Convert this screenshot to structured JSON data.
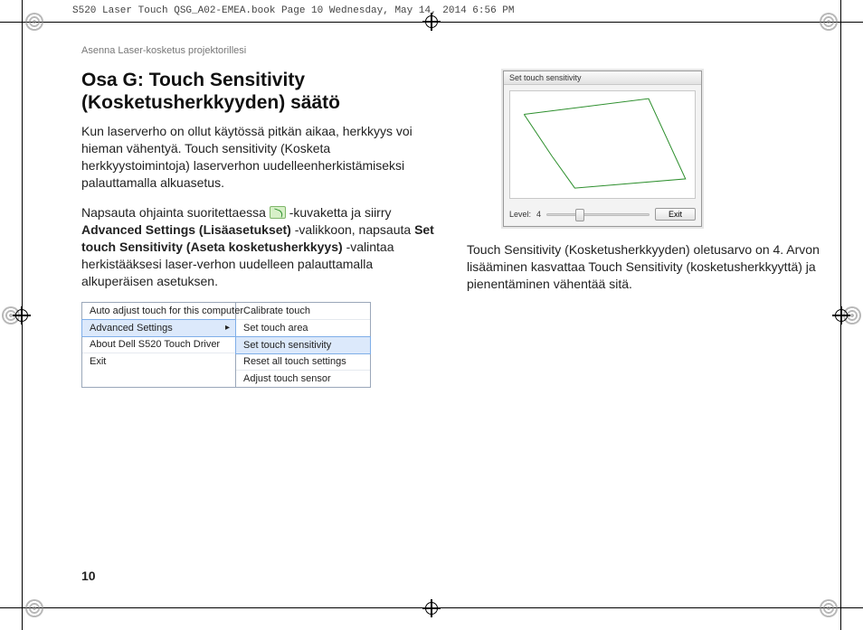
{
  "imprint": "S520 Laser Touch QSG_A02-EMEA.book  Page 10  Wednesday, May 14, 2014  6:56 PM",
  "running_head": "Asenna Laser-kosketus projektorillesi",
  "title_line1": "Osa G: Touch Sensitivity",
  "title_line2": "(Kosketusherkkyyden) säätö",
  "para1": "Kun laserverho on ollut käytössä pitkän aikaa, herkkyys voi hieman vähentyä. Touch sensitivity (Kosketa herkkyystoimintoja) laserverhon uudelleenherkistämiseksi palauttamalla alkuasetus.",
  "para2_pre": "Napsauta ohjainta suoritettaessa ",
  "para2_mid1": "-kuvaketta ja siirry ",
  "para2_b1": "Advanced Settings (Lisäasetukset)",
  "para2_mid2": " -valikkoon, napsauta ",
  "para2_b2": "Set touch Sensitivity (Aseta kosketusherkkyys)",
  "para2_post": " -valintaa herkistääksesi laser-verhon uudelleen palauttamalla alkuperäisen asetuksen.",
  "para3": "Touch Sensitivity (Kosketusherkkyyden) oletusarvo on 4. Arvon lisääminen kasvattaa Touch Sensitivity (kosketusherkkyyttä) ja pienentäminen vähentää sitä.",
  "menu_left": {
    "i0": "Auto adjust touch for this computer",
    "i1": "Advanced Settings",
    "i2": "About Dell S520 Touch Driver",
    "i3": "Exit"
  },
  "menu_right": {
    "i0": "Calibrate touch",
    "i1": "Set touch area",
    "i2": "Set touch sensitivity",
    "i3": "Reset all touch settings",
    "i4": "Adjust touch sensor"
  },
  "sens": {
    "title": "Set touch sensitivity",
    "level_label": "Level:",
    "level_value": "4",
    "exit": "Exit"
  },
  "page_number": "10"
}
